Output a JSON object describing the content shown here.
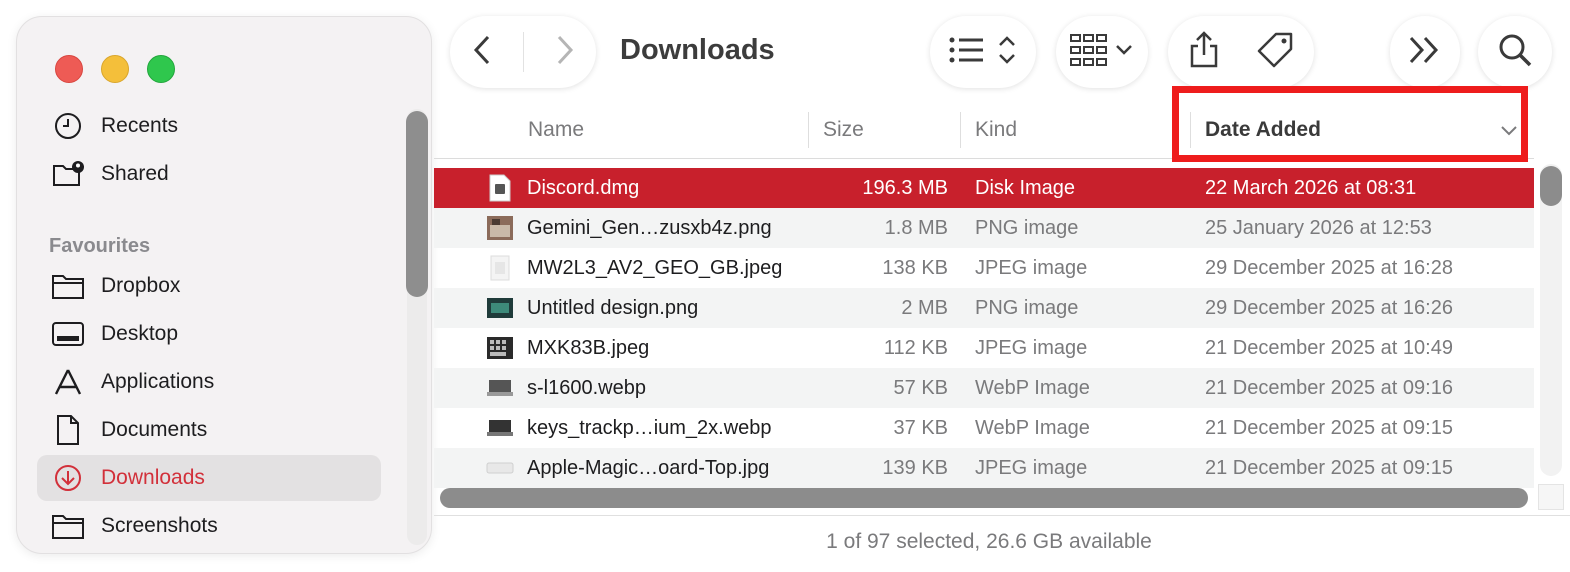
{
  "window": {
    "title": "Downloads"
  },
  "sidebar": {
    "section_heading": "Favourites",
    "items": [
      {
        "label": "Recents",
        "icon": "clock-icon"
      },
      {
        "label": "Shared",
        "icon": "shared-folder-icon"
      },
      {
        "label": "Dropbox",
        "icon": "folder-icon"
      },
      {
        "label": "Desktop",
        "icon": "desktop-icon"
      },
      {
        "label": "Applications",
        "icon": "applications-icon"
      },
      {
        "label": "Documents",
        "icon": "document-icon"
      },
      {
        "label": "Downloads",
        "icon": "download-icon",
        "active": true
      },
      {
        "label": "Screenshots",
        "icon": "folder-icon"
      }
    ]
  },
  "toolbar": {
    "back": "chevron-left-icon",
    "forward": "chevron-right-icon",
    "view": "list-view-icon",
    "group": "grid-group-icon",
    "share": "share-icon",
    "tag": "tag-icon",
    "more": "double-chevron-icon",
    "search": "search-icon"
  },
  "columns": {
    "name": "Name",
    "size": "Size",
    "kind": "Kind",
    "date": "Date Added"
  },
  "files": [
    {
      "name": "Discord.dmg",
      "size": "196.3 MB",
      "kind": "Disk Image",
      "date": "22 March 2026 at 08:31",
      "selected": true,
      "icon": "disk-image-icon"
    },
    {
      "name": "Gemini_Gen…zusxb4z.png",
      "size": "1.8 MB",
      "kind": "PNG image",
      "date": "25 January 2026 at 12:53",
      "icon": "image-thumbnail-icon"
    },
    {
      "name": "MW2L3_AV2_GEO_GB.jpeg",
      "size": "138 KB",
      "kind": "JPEG image",
      "date": "29 December 2025 at 16:28",
      "icon": "image-thumbnail-icon"
    },
    {
      "name": "Untitled design.png",
      "size": "2 MB",
      "kind": "PNG image",
      "date": "29 December 2025 at 16:26",
      "icon": "image-thumbnail-icon"
    },
    {
      "name": "MXK83B.jpeg",
      "size": "112 KB",
      "kind": "JPEG image",
      "date": "21 December 2025 at 10:49",
      "icon": "image-thumbnail-icon"
    },
    {
      "name": "s-l1600.webp",
      "size": "57 KB",
      "kind": "WebP Image",
      "date": "21 December 2025 at 09:16",
      "icon": "image-thumbnail-icon"
    },
    {
      "name": "keys_trackp…ium_2x.webp",
      "size": "37 KB",
      "kind": "WebP Image",
      "date": "21 December 2025 at 09:15",
      "icon": "image-thumbnail-icon"
    },
    {
      "name": "Apple-Magic…oard-Top.jpg",
      "size": "139 KB",
      "kind": "JPEG image",
      "date": "21 December 2025 at 09:15",
      "icon": "image-thumbnail-icon"
    }
  ],
  "status": "1 of 97 selected, 26.6 GB available",
  "colors": {
    "accent": "#c8202c",
    "highlight_box": "#ee1c1c"
  }
}
